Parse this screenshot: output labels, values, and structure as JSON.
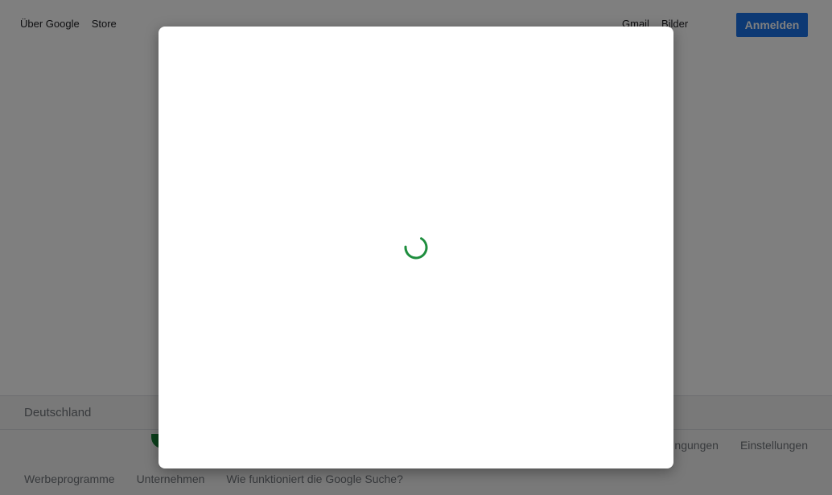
{
  "header": {
    "left_links": [
      "Über Google",
      "Store"
    ],
    "right_links": [
      "Gmail",
      "Bilder"
    ],
    "signin_label": "Anmelden"
  },
  "footer": {
    "country": "Deutschland",
    "row2_links": [
      "ngungen",
      "Einstellungen"
    ],
    "row3_links": [
      "Werbeprogramme",
      "Unternehmen",
      "Wie funktioniert die Google Suche?"
    ]
  },
  "dialog": {
    "state": "loading",
    "spinner_color": "#1e8e3e"
  },
  "colors": {
    "accent": "#1a73e8",
    "overlay": "rgba(0,0,0,0.5)"
  }
}
